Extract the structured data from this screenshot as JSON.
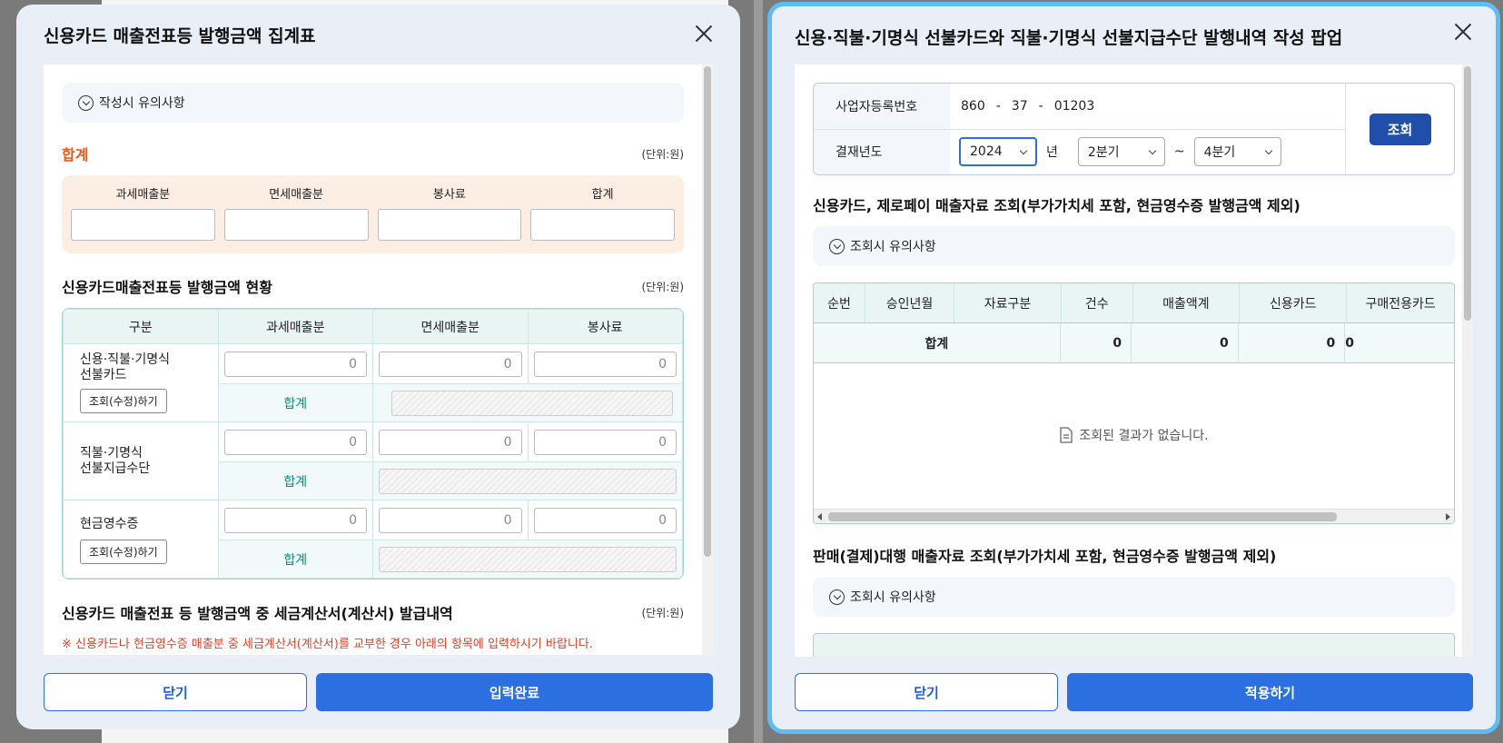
{
  "left": {
    "title": "신용카드 매출전표등 발행금액 집계표",
    "notice": "작성시 유의사항",
    "sum_title": "합계",
    "unit": "(단위:원)",
    "sum_cols": [
      "과세매출분",
      "면세매출분",
      "봉사료",
      "합계"
    ],
    "status_title": "신용카드매출전표등 발행금액 현황",
    "grid_headers": [
      "구분",
      "과세매출분",
      "면세매출분",
      "봉사료"
    ],
    "rows": [
      {
        "label1": "신용·직불·기명식",
        "label2": "선불카드",
        "button": "조회(수정)하기",
        "v1": "0",
        "v2": "0",
        "v3": "0",
        "sum_label": "합계"
      },
      {
        "label1": "직불·기명식",
        "label2": "선불지급수단",
        "button": "",
        "v1": "0",
        "v2": "0",
        "v3": "0",
        "sum_label": "합계"
      },
      {
        "label1": "현금영수증",
        "label2": "",
        "button": "조회(수정)하기",
        "v1": "0",
        "v2": "0",
        "v3": "0",
        "sum_label": "합계"
      }
    ],
    "invoice_title": "신용카드 매출전표 등 발행금액 중 세금계산서(계산서) 발급내역",
    "invoice_note": "※ 신용카드나 현금영수증 매출분 중 세금계산서(계산서)를 교부한 경우 아래의 항목에 입력하시기 바랍니다.",
    "btn_close": "닫기",
    "btn_done": "입력완료"
  },
  "right": {
    "title": "신용·직불·기명식 선불카드와 직불·기명식 선불지급수단 발행내역 작성 팝업",
    "biz_label": "사업자등록번호",
    "biz_parts": [
      "860",
      "-",
      "37",
      "-",
      "01203"
    ],
    "year_label": "결재년도",
    "year_value": "2024",
    "year_suffix": "년",
    "q_from": "2분기",
    "tilde": "~",
    "q_to": "4분기",
    "search_btn": "조회",
    "sec1_title": "신용카드, 제로페이 매출자료 조회(부가가치세 포함, 현금영수증 발행금액 제외)",
    "notice": "조회시 유의사항",
    "grid_headers": [
      "순번",
      "승인년월",
      "자료구분",
      "건수",
      "매출액계",
      "신용카드",
      "구매전용카드"
    ],
    "sum_label": "합계",
    "sum_values": [
      "0",
      "0",
      "0",
      "0"
    ],
    "empty": "조회된 결과가 없습니다.",
    "sec2_title": "판매(결제)대행 매출자료 조회(부가가치세 포함, 현금영수증 발행금액 제외)",
    "btn_close": "닫기",
    "btn_apply": "적용하기"
  },
  "colors": {
    "accent": "#2b6fe0",
    "sum_red": "#e65a1e",
    "teal": "#0a8a7f",
    "highlight": "#5cbdf3"
  }
}
